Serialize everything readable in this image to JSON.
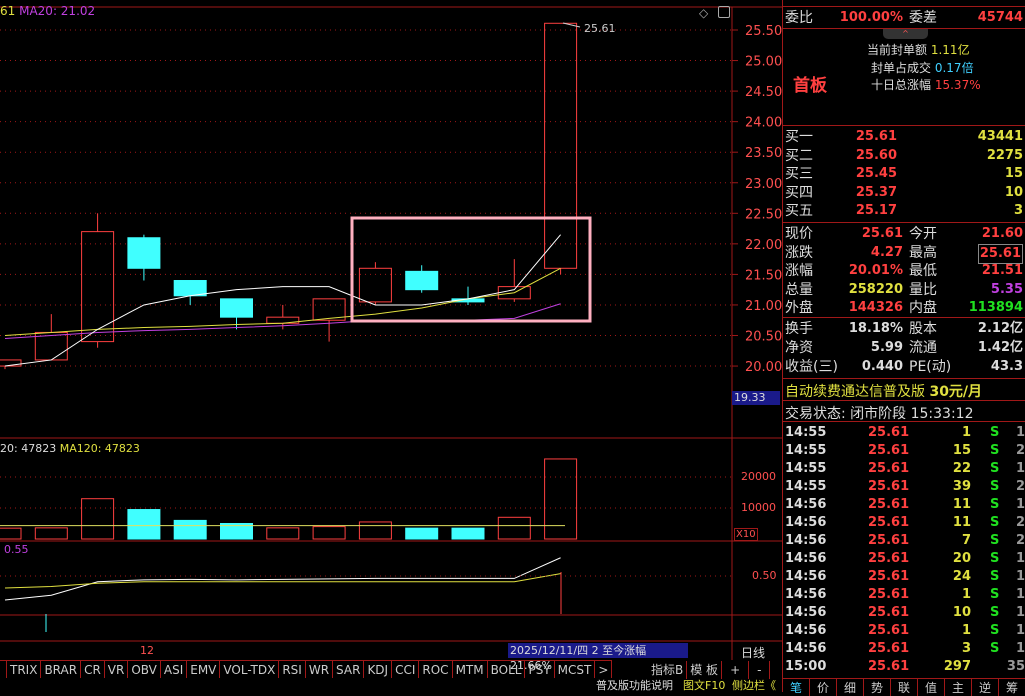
{
  "header": {
    "ma_prefix": "61",
    "ma20": "MA20: 21.02",
    "price_tag": "25.61",
    "current_price_axis": "19.33"
  },
  "volume": {
    "ma_label": "20: 47823",
    "ma120": "MA120: 47823",
    "unit": "X10",
    "ticks": [
      "20000",
      "10000"
    ]
  },
  "indicator": {
    "value": "0.55",
    "tick": "0.50"
  },
  "date_label": "12",
  "status_bar": "2025/12/11/四 2 至今涨幅21.66%",
  "period": "日线",
  "indicator_tabs": [
    "TRIX",
    "BRAR",
    "CR",
    "VR",
    "OBV",
    "ASI",
    "EMV",
    "VOL-TDX",
    "RSI",
    "WR",
    "SAR",
    "KDJ",
    "CCI",
    "ROC",
    "MTM",
    "BOLL",
    "PSY",
    "MCST",
    ">"
  ],
  "indicator_b": "指标B",
  "template": "模 板",
  "plus": "+",
  "minus": "-",
  "bottom_links": {
    "help": "普及版功能说明",
    "f10": "图文F10",
    "side": "侧边栏《"
  },
  "bottom_tabs": [
    "笔",
    "价",
    "细",
    "势",
    "联",
    "值",
    "主",
    "逆",
    "筹"
  ],
  "chart_data": {
    "type": "candlestick",
    "yticks": [
      "25.50",
      "25.00",
      "24.50",
      "24.00",
      "23.50",
      "23.00",
      "22.50",
      "22.00",
      "21.50",
      "21.00",
      "20.50",
      "20.00"
    ],
    "ylim": [
      20.0,
      25.5
    ],
    "candles": [
      [
        20.0,
        20.1,
        19.95,
        20.1
      ],
      [
        20.1,
        20.55,
        20.1,
        20.85
      ],
      [
        20.4,
        22.2,
        20.3,
        22.5
      ],
      [
        22.1,
        21.6,
        21.4,
        22.15
      ],
      [
        21.4,
        21.15,
        21.0,
        21.4
      ],
      [
        21.1,
        20.8,
        20.6,
        21.1
      ],
      [
        20.7,
        20.8,
        20.6,
        21.0
      ],
      [
        20.75,
        21.1,
        20.4,
        21.1
      ],
      [
        21.05,
        21.6,
        21.0,
        21.7
      ],
      [
        21.55,
        21.25,
        21.2,
        21.65
      ],
      [
        21.1,
        21.05,
        21.0,
        21.3
      ],
      [
        21.1,
        21.3,
        21.05,
        21.75
      ],
      [
        21.6,
        25.61,
        21.5,
        25.61
      ]
    ],
    "ma5": [
      20.0,
      20.1,
      20.6,
      21.0,
      21.15,
      21.25,
      21.3,
      21.3,
      21.0,
      21.0,
      21.1,
      21.25,
      22.15
    ],
    "ma10": [
      20.5,
      20.55,
      20.6,
      20.63,
      20.65,
      20.68,
      20.7,
      20.78,
      20.85,
      20.95,
      21.1,
      21.2,
      21.6
    ],
    "ma20": [
      20.45,
      20.5,
      20.55,
      20.58,
      20.6,
      20.63,
      20.66,
      20.7,
      20.75,
      20.75,
      20.75,
      20.78,
      21.02
    ],
    "volumes": [
      3500,
      3600,
      13000,
      9500,
      6000,
      5000,
      3600,
      4000,
      5500,
      3500,
      3500,
      7000,
      25822
    ],
    "vol_ma": 4300,
    "ind_white": [
      0.0,
      0.1,
      0.38,
      0.42,
      0.43,
      0.42,
      0.43,
      0.44,
      0.45,
      0.45,
      0.45,
      0.45,
      0.88
    ],
    "ind_yellow": [
      0.25,
      0.28,
      0.35,
      0.38,
      0.38,
      0.38,
      0.38,
      0.38,
      0.38,
      0.38,
      0.38,
      0.38,
      0.55
    ]
  },
  "right": {
    "top_partial": "",
    "wb_label": "委比",
    "wb": "100.00%",
    "wc_label": "委差",
    "wc": "45744",
    "seal_amount_label": "当前封单额",
    "seal_amount": "1.11亿",
    "seal_ratio_label": "封单占成交",
    "seal_ratio": "0.17倍",
    "ten_day_label": "十日总涨幅",
    "ten_day": "15.37%",
    "board": "首板",
    "bids": [
      {
        "l": "买一",
        "p": "25.61",
        "v": "43441"
      },
      {
        "l": "买二",
        "p": "25.60",
        "v": "2275"
      },
      {
        "l": "买三",
        "p": "25.45",
        "v": "15"
      },
      {
        "l": "买四",
        "p": "25.37",
        "v": "10"
      },
      {
        "l": "买五",
        "p": "25.17",
        "v": "3"
      }
    ],
    "quote": [
      {
        "l1": "现价",
        "v1": "25.61",
        "c1": "red",
        "l2": "今开",
        "v2": "21.60",
        "c2": "red"
      },
      {
        "l1": "涨跌",
        "v1": "4.27",
        "c1": "red",
        "l2": "最高",
        "v2": "25.61",
        "c2": "red"
      },
      {
        "l1": "涨幅",
        "v1": "20.01%",
        "c1": "red",
        "l2": "最低",
        "v2": "21.51",
        "c2": "red"
      },
      {
        "l1": "总量",
        "v1": "258220",
        "c1": "yel",
        "l2": "量比",
        "v2": "5.35",
        "c2": "mag"
      },
      {
        "l1": "外盘",
        "v1": "144326",
        "c1": "red",
        "l2": "内盘",
        "v2": "113894",
        "c2": "grn"
      }
    ],
    "fund": [
      {
        "l1": "换手",
        "v1": "18.18%",
        "l2": "股本",
        "v2": "2.12亿"
      },
      {
        "l1": "净资",
        "v1": "5.99",
        "l2": "流通",
        "v2": "1.42亿"
      },
      {
        "l1": "收益(三)",
        "v1": "0.440",
        "l2": "PE(动)",
        "v2": "43.3"
      }
    ],
    "promo": "自动续费通达信普及版",
    "promo_price": "30元/月",
    "trade_status": "交易状态: 闭市阶段 15:33:12",
    "ticks": [
      [
        "14:55",
        "25.61",
        "1",
        "S",
        "1"
      ],
      [
        "14:55",
        "25.61",
        "15",
        "S",
        "2"
      ],
      [
        "14:55",
        "25.61",
        "22",
        "S",
        "1"
      ],
      [
        "14:55",
        "25.61",
        "39",
        "S",
        "2"
      ],
      [
        "14:56",
        "25.61",
        "11",
        "S",
        "1"
      ],
      [
        "14:56",
        "25.61",
        "11",
        "S",
        "2"
      ],
      [
        "14:56",
        "25.61",
        "7",
        "S",
        "2"
      ],
      [
        "14:56",
        "25.61",
        "20",
        "S",
        "1"
      ],
      [
        "14:56",
        "25.61",
        "24",
        "S",
        "1"
      ],
      [
        "14:56",
        "25.61",
        "1",
        "S",
        "1"
      ],
      [
        "14:56",
        "25.61",
        "10",
        "S",
        "1"
      ],
      [
        "14:56",
        "25.61",
        "1",
        "S",
        "1"
      ],
      [
        "14:56",
        "25.61",
        "3",
        "S",
        "1"
      ],
      [
        "15:00",
        "25.61",
        "297",
        "",
        "35"
      ]
    ]
  },
  "colors": {
    "up": "#ff4040",
    "down": "#40ffff",
    "grid": "#a01818",
    "highlight": "#ffb0c0"
  }
}
